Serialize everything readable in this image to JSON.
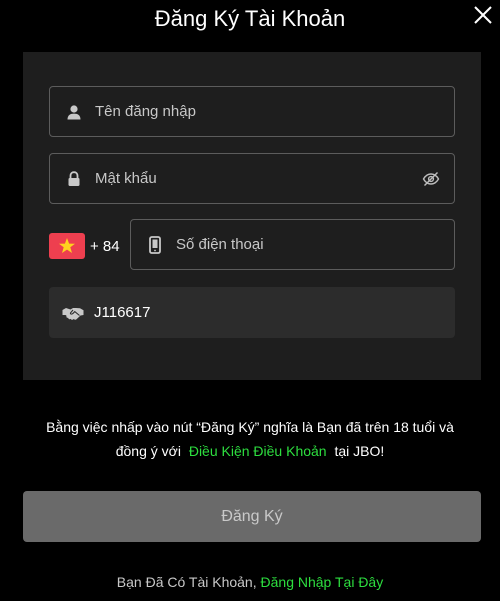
{
  "header": {
    "title": "Đăng Ký Tài Khoản",
    "close_icon": "close-icon"
  },
  "form": {
    "username": {
      "placeholder": "Tên đăng nhập",
      "value": "",
      "icon": "user-icon"
    },
    "password": {
      "placeholder": "Mật khẩu",
      "value": "",
      "icon": "lock-icon",
      "toggle_icon": "eye-off-icon"
    },
    "phone": {
      "country_flag": "vietnam-flag-icon",
      "dial_code": "+ 84",
      "placeholder": "Số điện thoại",
      "value": "",
      "icon": "mobile-phone-icon"
    },
    "referral": {
      "value": "J116617",
      "icon": "handshake-icon"
    }
  },
  "terms": {
    "line1": "Bằng việc nhấp vào nút “Đăng Ký” nghĩa là Bạn đã trên 18 tuổi và",
    "line2_prefix": "đồng ý với",
    "link_label": "Điều Kiện Điều Khoản",
    "line2_suffix": "tại JBO!"
  },
  "submit": {
    "label": "Đăng Ký"
  },
  "footer": {
    "prompt": "Bạn Đã Có Tài Khoản,",
    "login_link": "Đăng Nhập Tại Đây"
  },
  "colors": {
    "background": "#000000",
    "card": "#1e1e1e",
    "accent_green": "#2dde3f",
    "flag_red": "#ee3f4f",
    "button_disabled": "#6a6a6a"
  }
}
